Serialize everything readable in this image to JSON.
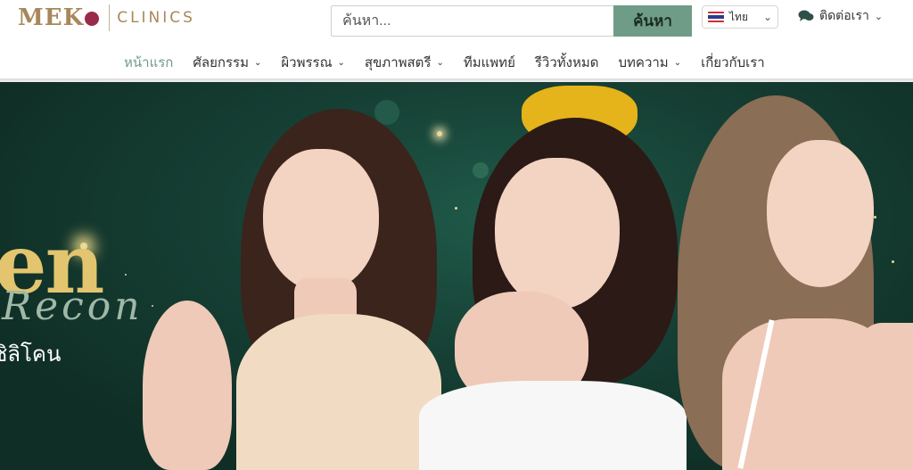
{
  "header": {
    "logo": {
      "word1": "MEK",
      "word1_end": "",
      "word2": "CLINICS"
    },
    "search": {
      "placeholder": "ค้นหา...",
      "button_label": "ค้นหา"
    },
    "language": {
      "label": "ไทย"
    },
    "contact": {
      "label": "ติดต่อเรา"
    }
  },
  "nav": {
    "items": [
      {
        "label": "หน้าแรก",
        "has_dropdown": false,
        "active": true
      },
      {
        "label": "ศัลยกรรม",
        "has_dropdown": true
      },
      {
        "label": "ผิวพรรณ",
        "has_dropdown": true
      },
      {
        "label": "สุขภาพสตรี",
        "has_dropdown": true
      },
      {
        "label": "ทีมแพทย์",
        "has_dropdown": false
      },
      {
        "label": "รีวิวทั้งหมด",
        "has_dropdown": false
      },
      {
        "label": "บทความ",
        "has_dropdown": true
      },
      {
        "label": "เกี่ยวกับเรา",
        "has_dropdown": false
      }
    ]
  },
  "banner": {
    "big_text": "en",
    "script_text": "Recon",
    "thai_text": "ซิลิโคน"
  },
  "colors": {
    "accent": "#6f9c86",
    "logo_gold": "#a8885a",
    "banner_green": "#163f34",
    "bow_gold": "#e5b31a"
  },
  "icons": {
    "chat": "chat-bubbles-icon",
    "chevron": "chevron-down-icon",
    "flag": "thailand-flag-icon"
  }
}
